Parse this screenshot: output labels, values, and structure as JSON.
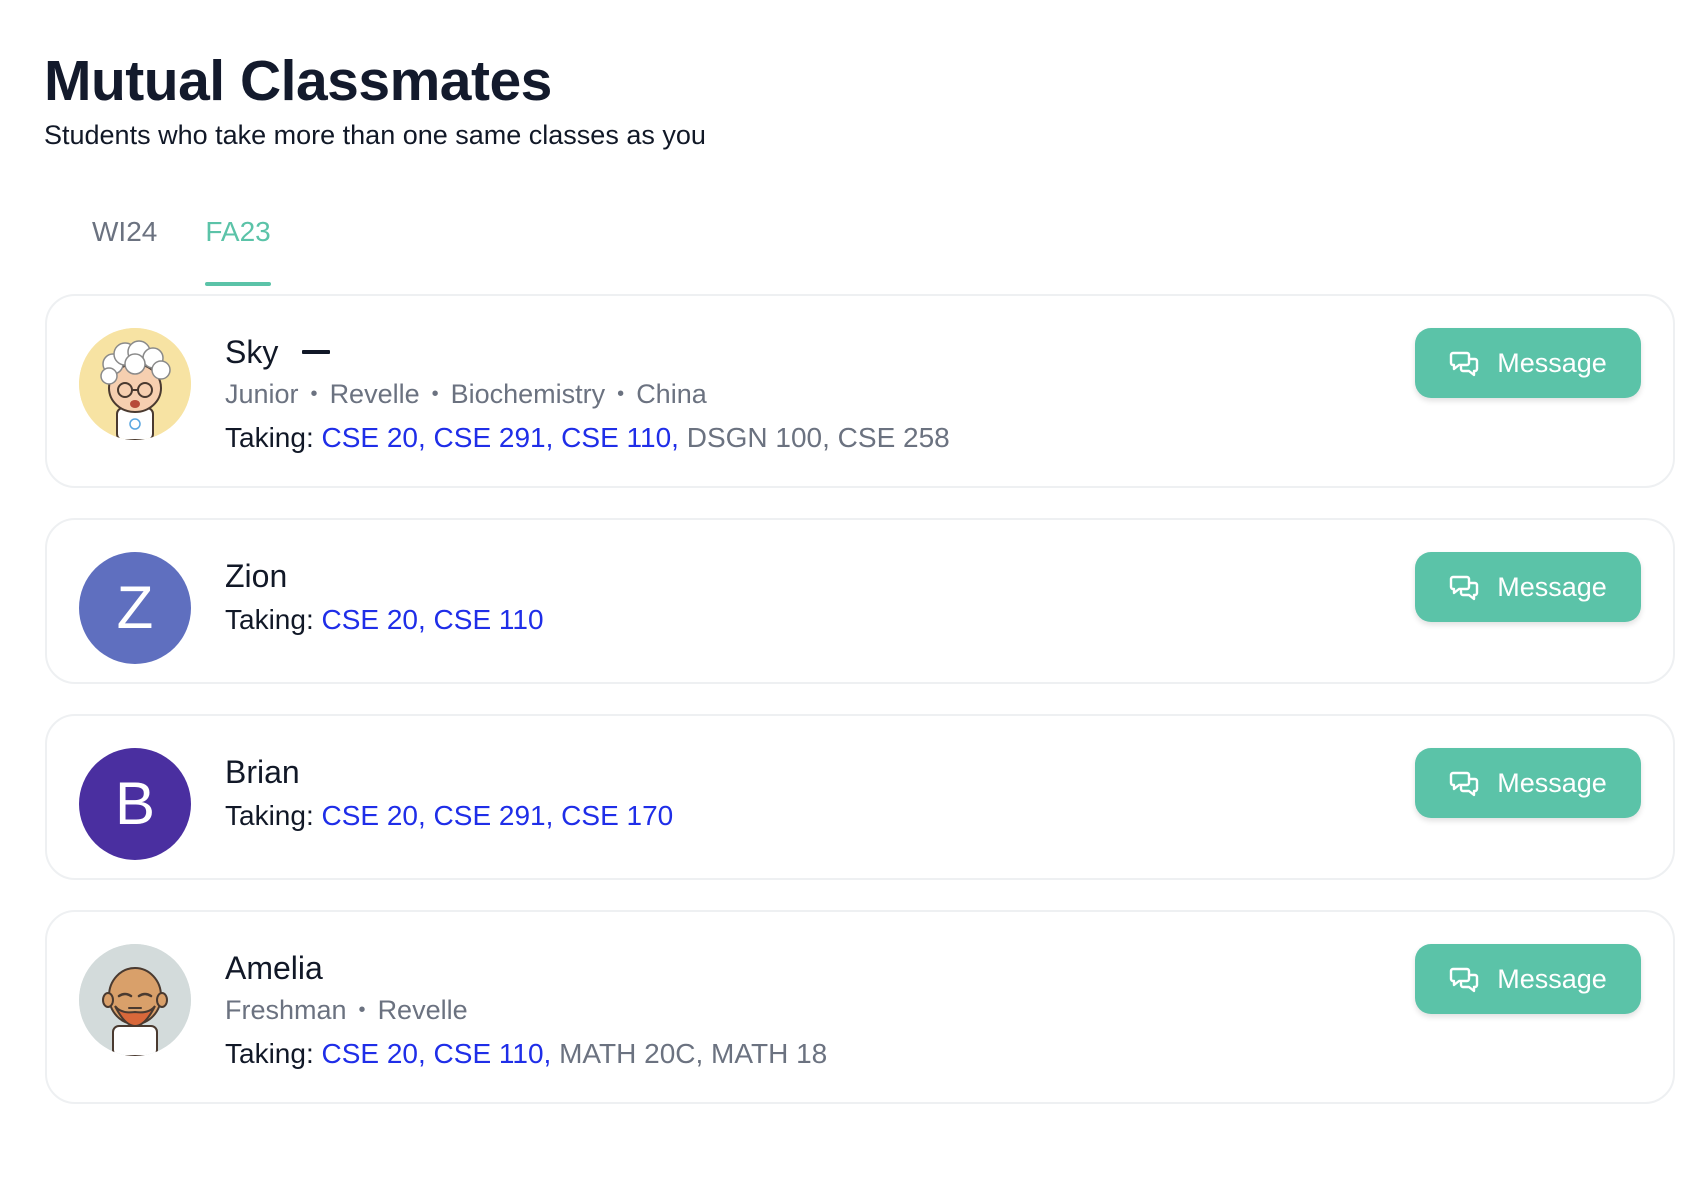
{
  "header": {
    "title": "Mutual Classmates",
    "subtitle": "Students who take more than one same classes as you"
  },
  "tabs": [
    {
      "label": "WI24",
      "active": false
    },
    {
      "label": "FA23",
      "active": true
    }
  ],
  "colors": {
    "accent": "#5bc3a8",
    "mutual_course": "#1f2ee8",
    "other_course": "#6b7280"
  },
  "students": [
    {
      "name": "Sky",
      "avatar": {
        "type": "image",
        "icon": "grandma-avatar-icon",
        "bg": "#f7e3a3"
      },
      "meta": [
        "Junior",
        "Revelle",
        "Biochemistry",
        "China"
      ],
      "taking_label": "Taking:",
      "mutual_courses": "CSE 20, CSE 291, CSE 110,",
      "other_courses": "DSGN 100, CSE 258",
      "message_label": "Message"
    },
    {
      "name": "Zion",
      "avatar": {
        "type": "letter",
        "letter": "Z",
        "bg": "#5f6fbf"
      },
      "meta": [],
      "taking_label": "Taking:",
      "mutual_courses": "CSE 20, CSE 110",
      "other_courses": "",
      "message_label": "Message"
    },
    {
      "name": "Brian",
      "avatar": {
        "type": "letter",
        "letter": "B",
        "bg": "#4a2fa0"
      },
      "meta": [],
      "taking_label": "Taking:",
      "mutual_courses": "CSE 20, CSE 291, CSE 170",
      "other_courses": "",
      "message_label": "Message"
    },
    {
      "name": "Amelia",
      "avatar": {
        "type": "image",
        "icon": "bearded-man-avatar-icon",
        "bg": "#d3dbdb"
      },
      "meta": [
        "Freshman",
        "Revelle"
      ],
      "taking_label": "Taking:",
      "mutual_courses": "CSE 20, CSE 110,",
      "other_courses": "MATH 20C, MATH 18",
      "message_label": "Message"
    }
  ]
}
